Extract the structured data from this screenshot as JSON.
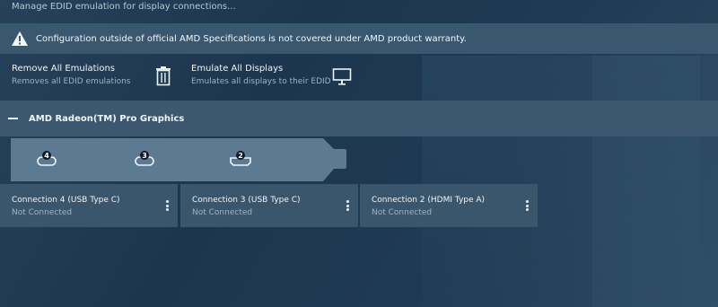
{
  "header": {
    "subtitle": "Manage EDID emulation for display connections..."
  },
  "warning": {
    "icon": "warning-triangle-icon",
    "text": "Configuration outside of official AMD Specifications is not covered under AMD product warranty."
  },
  "actions": [
    {
      "label": "Remove All Emulations",
      "description": "Removes all EDID emulations",
      "icon": "trash-icon"
    },
    {
      "label": "Emulate All Displays",
      "description": "Emulates all displays to their EDID",
      "icon": "monitor-icon"
    }
  ],
  "gpu": {
    "name": "AMD Radeon(TM) Pro Graphics",
    "ports": [
      {
        "number": "4",
        "type": "usb-c"
      },
      {
        "number": "3",
        "type": "usb-c"
      },
      {
        "number": "2",
        "type": "hdmi"
      }
    ],
    "connections": [
      {
        "title": "Connection 4 (USB Type C)",
        "status": "Not Connected"
      },
      {
        "title": "Connection 3 (USB Type C)",
        "status": "Not Connected"
      },
      {
        "title": "Connection 2 (HDMI Type A)",
        "status": "Not Connected"
      }
    ]
  },
  "colors": {
    "background": "#1f3a54",
    "panel": "#3a566d",
    "text": "#f2f5f8",
    "muted": "#9fb2c2"
  }
}
